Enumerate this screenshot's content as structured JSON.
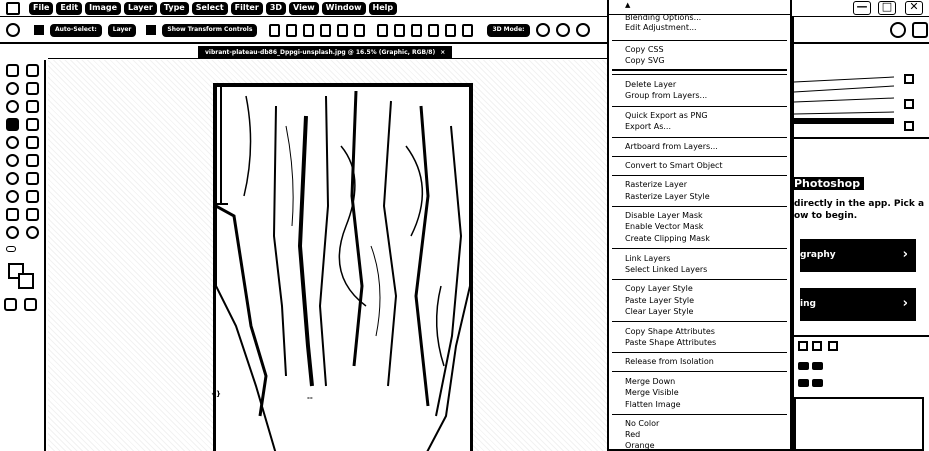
{
  "menubar": {
    "items": [
      "File",
      "Edit",
      "Image",
      "Layer",
      "Type",
      "Select",
      "Filter",
      "3D",
      "View",
      "Window",
      "Help"
    ]
  },
  "window_controls": {
    "minimize": "—",
    "maximize": "□",
    "close": "✕"
  },
  "options_bar": {
    "auto_select_label": "Auto-Select:",
    "auto_select_value": "Layer",
    "show_transform_label": "Show Transform Controls",
    "mode_3d_label": "3D Mode:"
  },
  "document_tab": {
    "title": "vibrant-plateau-db86_Dppgi-unsplash.jpg @ 16.5% (Graphic, RGB/8)",
    "close": "×"
  },
  "context_menu": {
    "scroll_up": "▲",
    "groups": [
      [
        "Blending Options...",
        "Edit Adjustment..."
      ],
      [
        "Copy CSS",
        "Copy SVG"
      ],
      [
        "Delete Layer",
        "Group from Layers..."
      ],
      [
        "Quick Export as PNG",
        "Export As..."
      ],
      [
        "Artboard from Layers..."
      ],
      [
        "Convert to Smart Object"
      ],
      [
        "Rasterize Layer",
        "Rasterize Layer Style"
      ],
      [
        "Disable Layer Mask",
        "Enable Vector Mask",
        "Create Clipping Mask"
      ],
      [
        "Link Layers",
        "Select Linked Layers"
      ],
      [
        "Copy Layer Style",
        "Paste Layer Style",
        "Clear Layer Style"
      ],
      [
        "Copy Shape Attributes",
        "Paste Shape Attributes"
      ],
      [
        "Release from Isolation"
      ],
      [
        "Merge Down",
        "Merge Visible",
        "Flatten Image"
      ],
      [
        "No Color",
        "Red",
        "Orange"
      ]
    ]
  },
  "right_panel": {
    "learn_title": "Photoshop",
    "learn_subtitle_1": "directly in the app. Pick a",
    "learn_subtitle_2": "ow to begin.",
    "tutorial_1": "graphy",
    "tutorial_2": "ing",
    "chevron": "›"
  },
  "document_marks": {
    "corner_glyph": "{}",
    "bottom_dash": "--"
  }
}
